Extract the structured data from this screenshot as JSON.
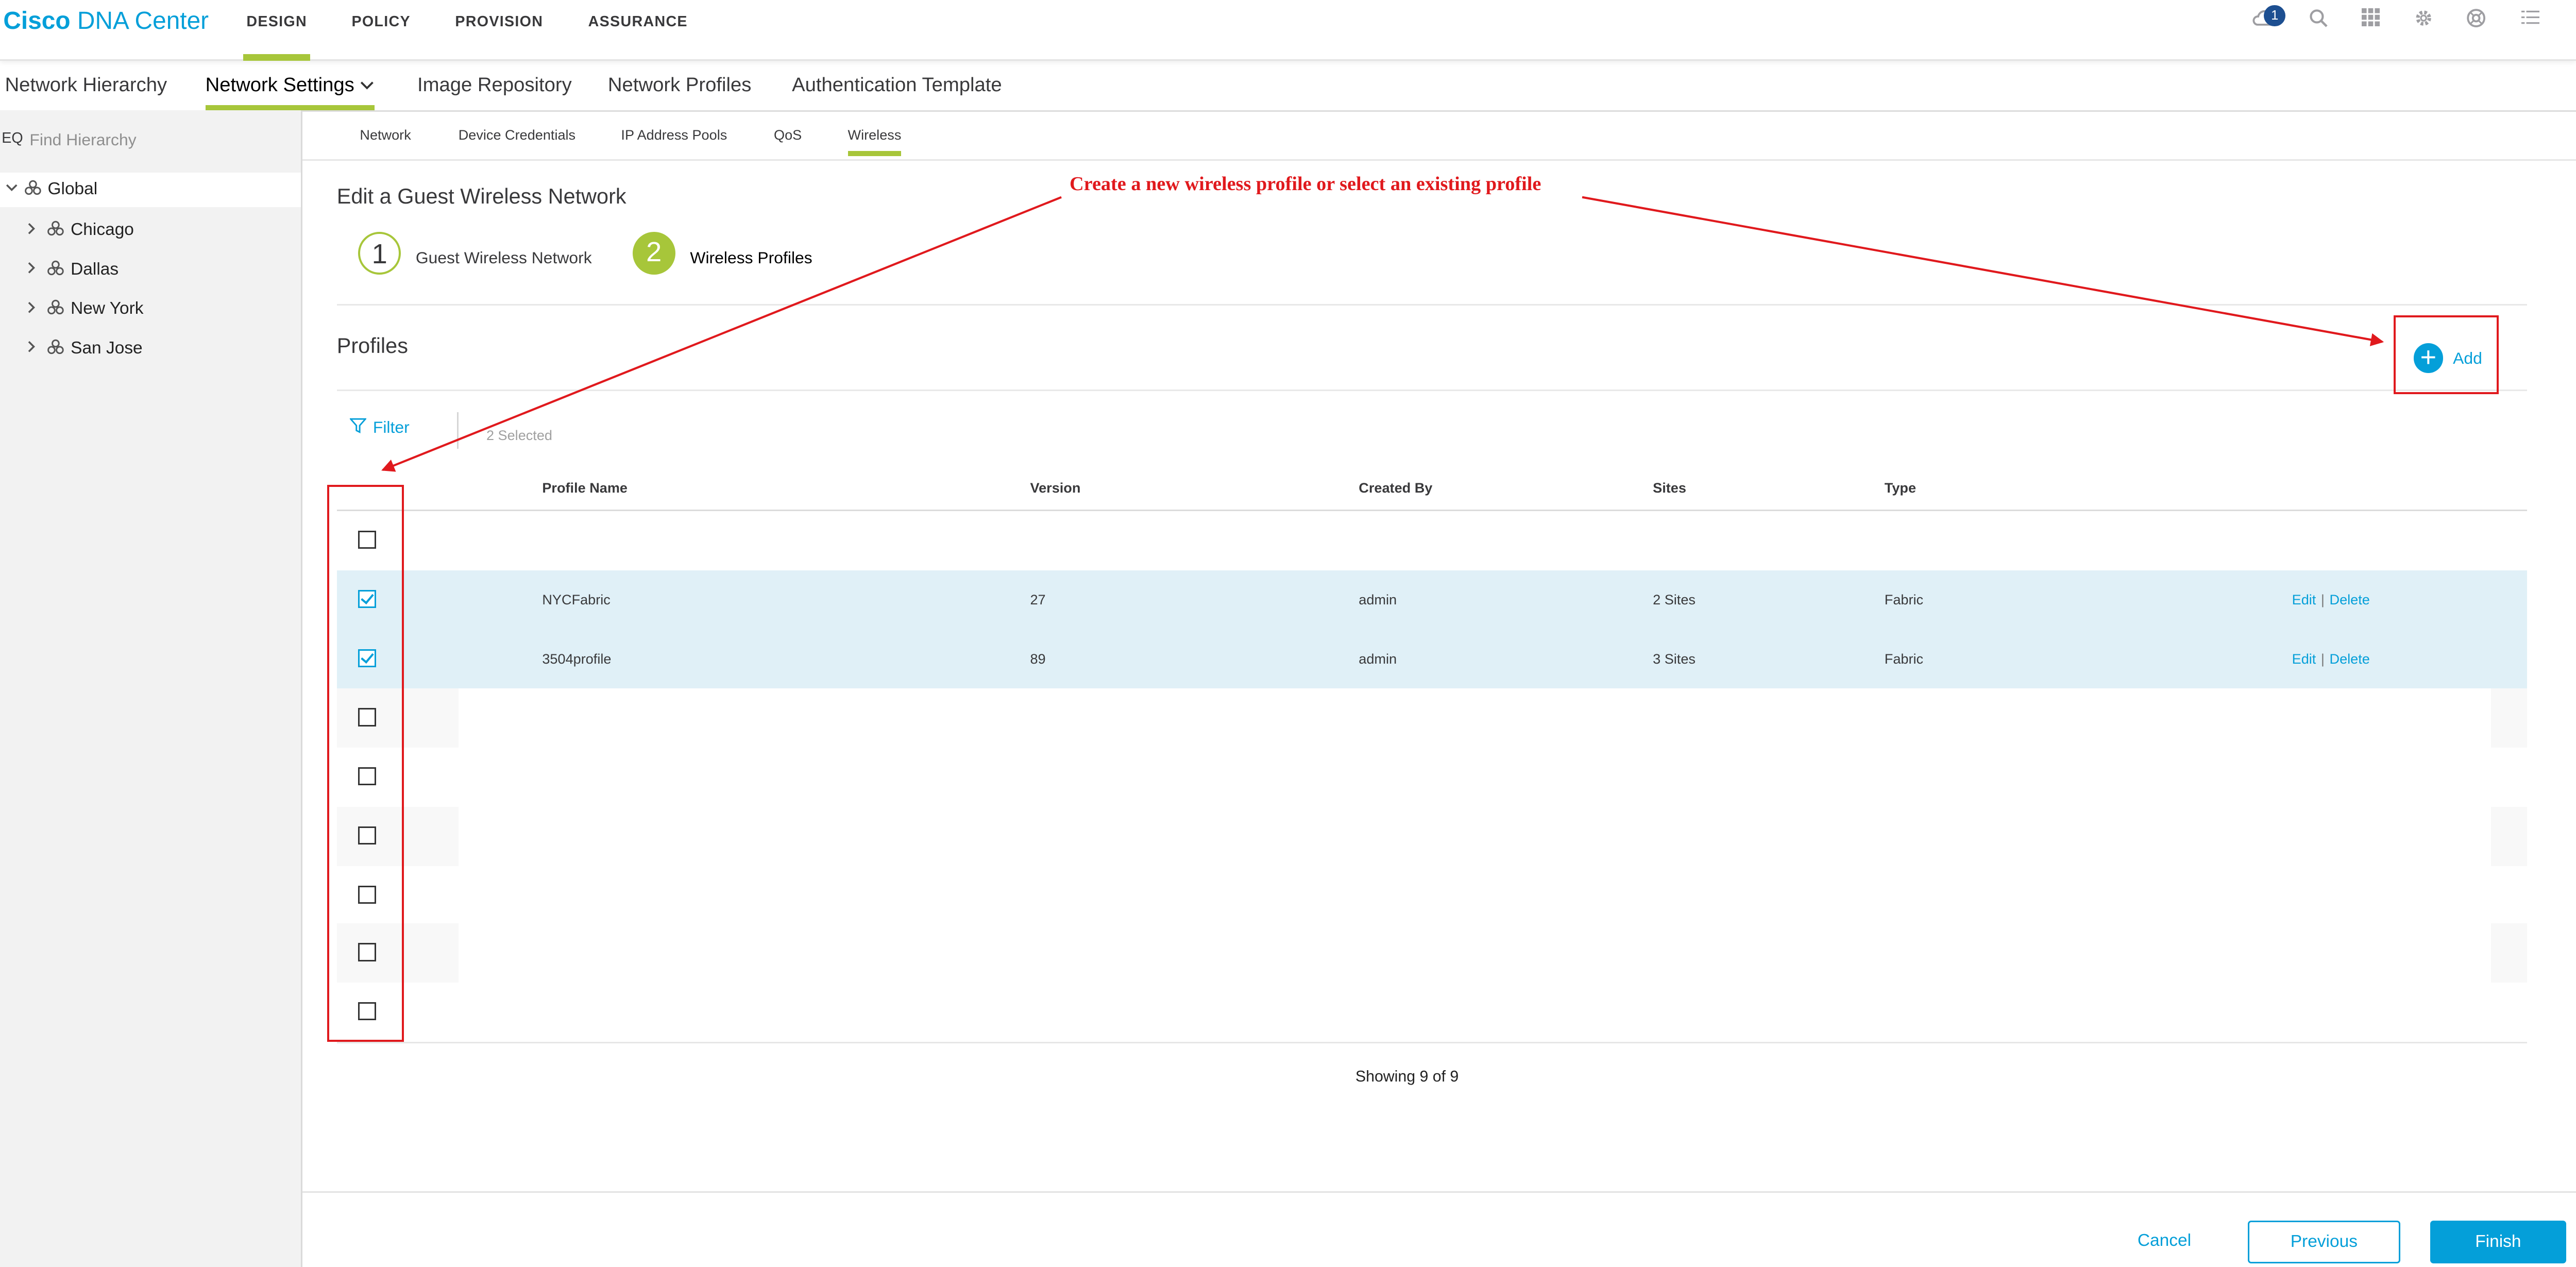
{
  "app": {
    "brand_bold": "Cisco",
    "brand_rest": "DNA Center"
  },
  "topnav": [
    "DESIGN",
    "POLICY",
    "PROVISION",
    "ASSURANCE"
  ],
  "notifications": {
    "count": "1"
  },
  "icons": [
    "cloud-icon",
    "search-icon",
    "apps-grid-icon",
    "gear-icon",
    "help-icon",
    "menu-list-icon"
  ],
  "secnav": [
    "Network Hierarchy",
    "Network Settings",
    "Image Repository",
    "Network Profiles",
    "Authentication Template"
  ],
  "sidebar": {
    "search_icon_label": "EQ",
    "search_placeholder": "Find Hierarchy",
    "root": "Global",
    "sites": [
      "Chicago",
      "Dallas",
      "New York",
      "San Jose"
    ]
  },
  "tabs": [
    "Network",
    "Device Credentials",
    "IP Address Pools",
    "QoS",
    "Wireless"
  ],
  "wizard": {
    "title": "Edit a Guest Wireless Network",
    "steps": [
      {
        "num": "1",
        "label": "Guest Wireless Network"
      },
      {
        "num": "2",
        "label": "Wireless Profiles"
      }
    ]
  },
  "profiles": {
    "title": "Profiles",
    "add_label": "Add",
    "filter_label": "Filter",
    "selected_text": "2 Selected",
    "columns": [
      "Profile Name",
      "Version",
      "Created By",
      "Sites",
      "Type"
    ],
    "rows": [
      {
        "name": "NYCFabric",
        "version": "27",
        "created_by": "admin",
        "sites": "2 Sites",
        "type": "Fabric",
        "checked": true
      },
      {
        "name": "3504profile",
        "version": "89",
        "created_by": "admin",
        "sites": "3 Sites",
        "type": "Fabric",
        "checked": true
      }
    ],
    "edit_label": "Edit",
    "delete_label": "Delete",
    "separator": "|",
    "showing": "Showing 9 of 9"
  },
  "footer": {
    "cancel": "Cancel",
    "previous": "Previous",
    "finish": "Finish"
  },
  "annotation": {
    "text": "Create a new wireless profile or select an existing profile",
    "color": "#e0191d"
  },
  "colors": {
    "accent": "#049fd9",
    "green": "#a7c63a",
    "selected_row": "#e0f0f7"
  }
}
